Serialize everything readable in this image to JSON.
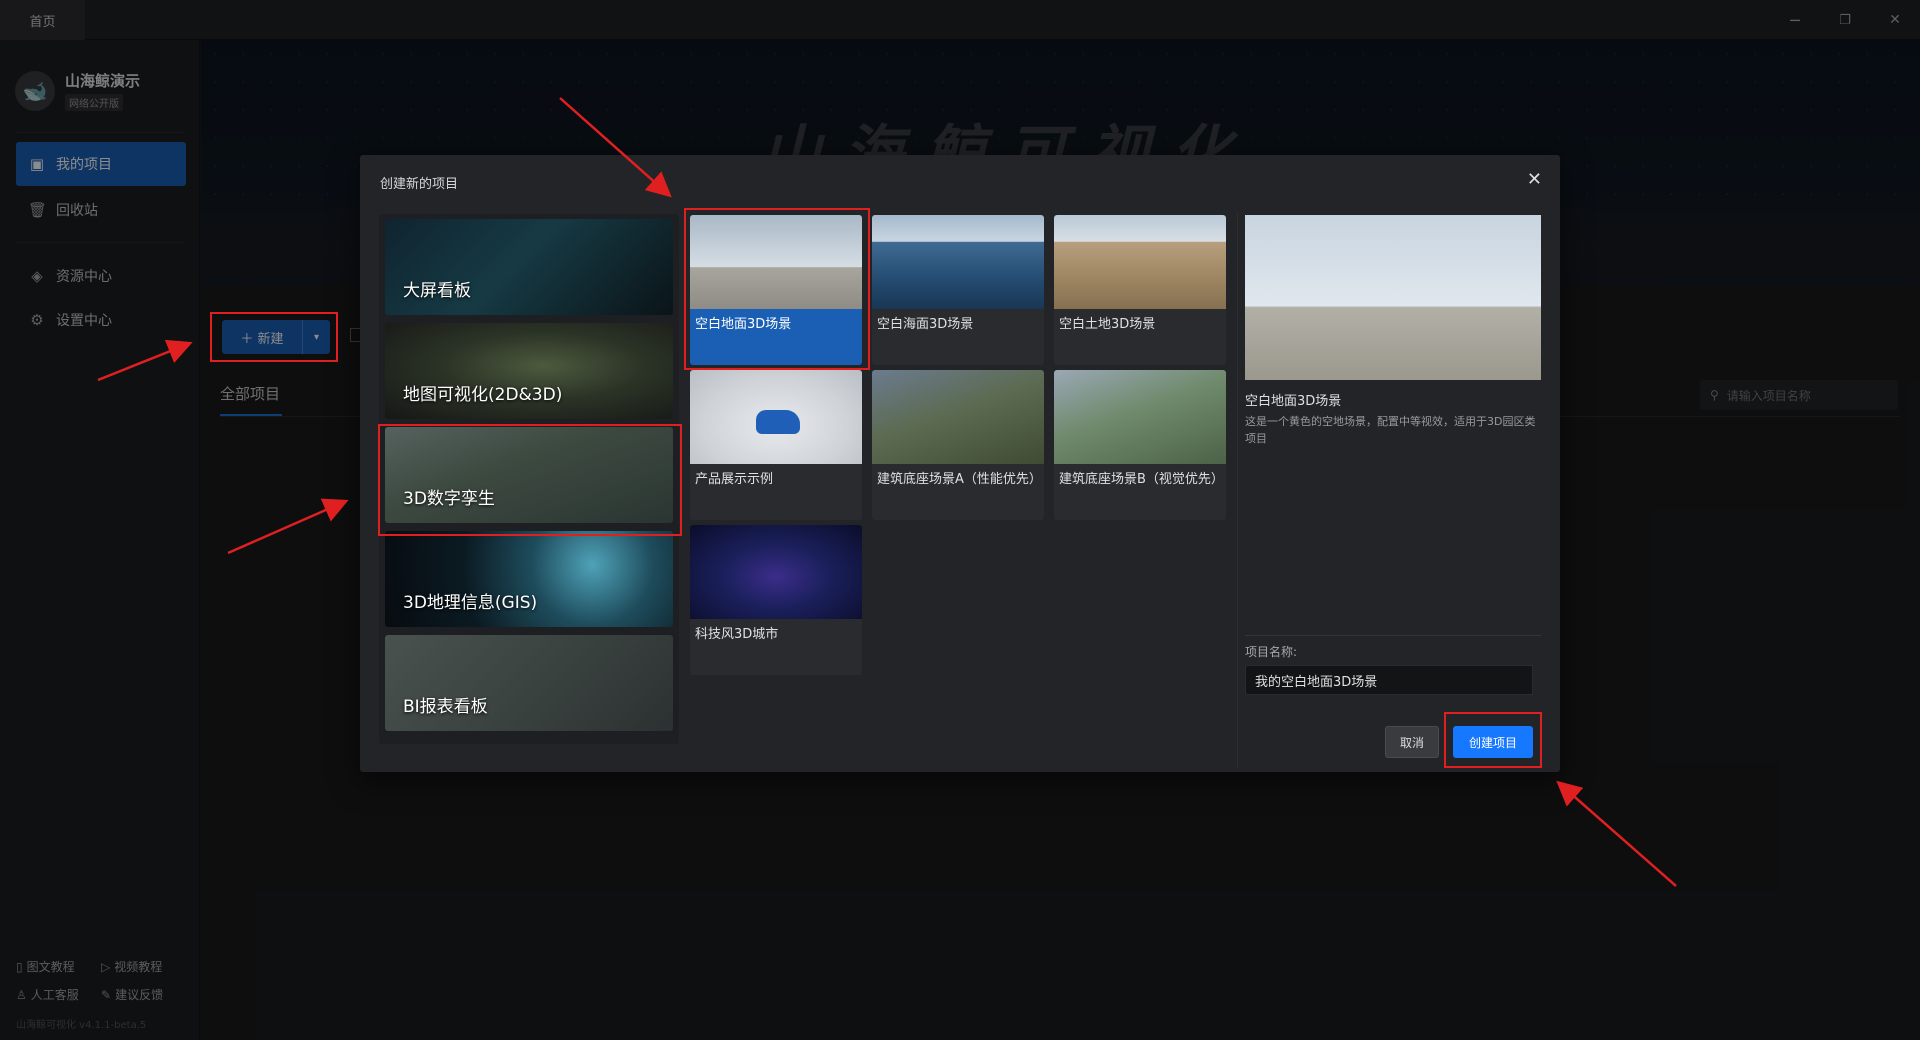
{
  "titlebar": {
    "home_tab": "首页",
    "minimize_icon": "─",
    "restore_icon": "❐",
    "close_icon": "✕"
  },
  "sidebar": {
    "brand_name": "山海鲸演示",
    "brand_badge": "网络公开版",
    "items": [
      {
        "label": "我的项目",
        "icon": "▣"
      },
      {
        "label": "回收站",
        "icon": "🗑"
      },
      {
        "label": "资源中心",
        "icon": "◈"
      },
      {
        "label": "设置中心",
        "icon": "⚙"
      }
    ],
    "footer": [
      {
        "label": "图文教程",
        "icon": "▯"
      },
      {
        "label": "视频教程",
        "icon": "▷"
      },
      {
        "label": "人工客服",
        "icon": "♙"
      },
      {
        "label": "建议反馈",
        "icon": "✎"
      }
    ],
    "version": "山海鲸可视化 v4.1.1-beta.5"
  },
  "main": {
    "banner_title": "山海鲸可视化",
    "new_button": "＋ 新建",
    "new_dropdown_icon": "▾",
    "tab_all": "全部项目",
    "search_placeholder": "请输入项目名称",
    "search_icon": "⚲"
  },
  "modal": {
    "title": "创建新的项目",
    "close_icon": "✕",
    "categories": [
      {
        "label": "大屏看板"
      },
      {
        "label": "地图可视化(2D&3D)"
      },
      {
        "label": "3D数字孪生"
      },
      {
        "label": "3D地理信息(GIS)"
      },
      {
        "label": "BI报表看板"
      }
    ],
    "templates": [
      {
        "label": "空白地面3D场景"
      },
      {
        "label": "空白海面3D场景"
      },
      {
        "label": "空白土地3D场景"
      },
      {
        "label": "产品展示示例"
      },
      {
        "label": "建筑底座场景A（性能优先）"
      },
      {
        "label": "建筑底座场景B（视觉优先）"
      },
      {
        "label": "科技风3D城市"
      }
    ],
    "preview": {
      "name": "空白地面3D场景",
      "description": "这是一个黄色的空地场景，配置中等视效，适用于3D园区类项目"
    },
    "project_name_label": "项目名称:",
    "project_name_value": "我的空白地面3D场景",
    "cancel": "取消",
    "create": "创建项目"
  }
}
